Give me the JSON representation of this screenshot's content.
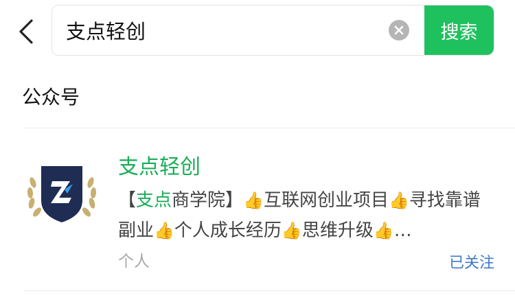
{
  "search": {
    "query": "支点轻创",
    "button_label": "搜索"
  },
  "section": {
    "title": "公众号"
  },
  "result": {
    "name": "支点轻创",
    "desc_open": "【",
    "desc_highlight": "支点",
    "desc_rest": "商学院】",
    "desc_items": [
      "互联网创业项目",
      "寻找靠谱副业",
      "个人成长经历",
      "思维升级"
    ],
    "desc_ellipsis": "…",
    "type": "个人",
    "follow_status": "已关注"
  },
  "colors": {
    "accent_green": "#1fc15e",
    "highlight_green": "#1aad57",
    "follow_blue": "#3f79c3"
  },
  "icons": {
    "back": "chevron-left-icon",
    "clear": "clear-icon",
    "list_marker": "thumbs-up-icon"
  }
}
